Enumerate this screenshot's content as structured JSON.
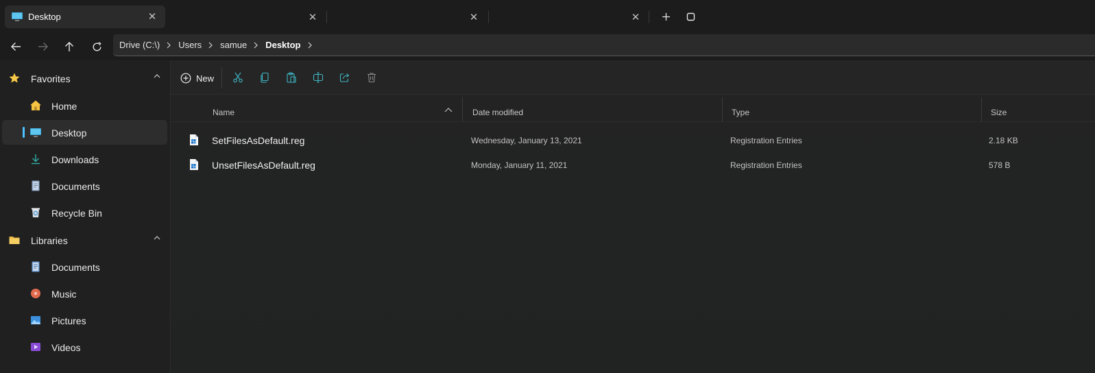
{
  "tabs": [
    {
      "title": "Desktop",
      "icon": "desktop-icon",
      "active": true
    },
    {
      "title": "",
      "active": false
    },
    {
      "title": "",
      "active": false
    },
    {
      "title": "",
      "active": false
    }
  ],
  "titlebar": {
    "new_tab_icon": "plus-icon",
    "tab_overview_icon": "restore-icon"
  },
  "navigation": {
    "back_icon": "arrow-left-icon",
    "forward_icon": "arrow-right-icon",
    "up_icon": "arrow-up-icon",
    "refresh_icon": "refresh-icon",
    "breadcrumbs": [
      "Drive (C:\\)",
      "Users",
      "samue",
      "Desktop"
    ]
  },
  "sidebar": {
    "favorites": {
      "label": "Favorites",
      "icon": "star-icon",
      "items": [
        {
          "label": "Home",
          "icon": "home-icon"
        },
        {
          "label": "Desktop",
          "icon": "desktop-icon",
          "selected": true
        },
        {
          "label": "Downloads",
          "icon": "download-icon"
        },
        {
          "label": "Documents",
          "icon": "document-icon"
        },
        {
          "label": "Recycle Bin",
          "icon": "recycle-bin-icon"
        }
      ]
    },
    "libraries": {
      "label": "Libraries",
      "icon": "folder-icon",
      "items": [
        {
          "label": "Documents",
          "icon": "document-icon"
        },
        {
          "label": "Music",
          "icon": "music-icon"
        },
        {
          "label": "Pictures",
          "icon": "picture-icon"
        },
        {
          "label": "Videos",
          "icon": "video-icon"
        }
      ]
    }
  },
  "toolbar": {
    "new_label": "New",
    "buttons": [
      "cut-icon",
      "copy-icon",
      "paste-icon",
      "rename-icon",
      "share-icon",
      "delete-icon"
    ]
  },
  "columns": {
    "name": "Name",
    "date": "Date modified",
    "type": "Type",
    "size": "Size"
  },
  "files": [
    {
      "name": "SetFilesAsDefault.reg",
      "date": "Wednesday, January 13, 2021",
      "type": "Registration Entries",
      "size": "2.18 KB",
      "icon": "registry-file-icon"
    },
    {
      "name": "UnsetFilesAsDefault.reg",
      "date": "Monday, January 11, 2021",
      "type": "Registration Entries",
      "size": "578 B",
      "icon": "registry-file-icon"
    }
  ],
  "colors": {
    "accent": "#4cc2ff",
    "favorite_star": "#f7c948",
    "home_yellow": "#f5c342",
    "toolbar_icon": "#3fb8c7"
  }
}
